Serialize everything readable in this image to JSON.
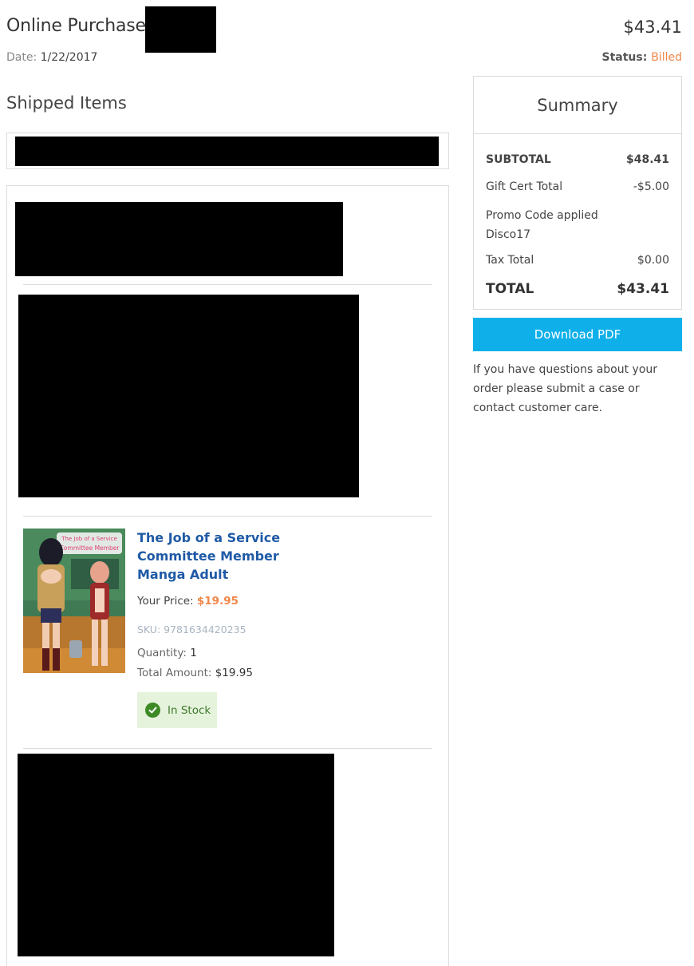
{
  "header": {
    "title": "Online Purchase",
    "date_label": "Date:",
    "date_value": "1/22/2017",
    "grand_total": "$43.41",
    "status_label": "Status:",
    "status_value": "Billed"
  },
  "shipped": {
    "title": "Shipped Items"
  },
  "product": {
    "name": "The Job of a Service Committee Member Manga Adult",
    "price_label": "Your Price:",
    "price_value": "$19.95",
    "sku_label": "SKU:",
    "sku_value": "9781634420235",
    "quantity_label": "Quantity:",
    "quantity_value": "1",
    "total_label": "Total Amount:",
    "total_value": "$19.95",
    "stock_status": "In Stock",
    "cover_title_line1": "The Job of a Service",
    "cover_title_line2": "Committee Member"
  },
  "summary": {
    "title": "Summary",
    "subtotal_label": "SUBTOTAL",
    "subtotal_value": "$48.41",
    "gift_label": "Gift Cert Total",
    "gift_value": "-$5.00",
    "promo_label": "Promo Code applied",
    "promo_code": "Disco17",
    "tax_label": "Tax Total",
    "tax_value": "$0.00",
    "total_label": "TOTAL",
    "total_value": "$43.41"
  },
  "actions": {
    "download_pdf": "Download PDF"
  },
  "help_text": "If you have questions about your order please submit a case or contact customer care.",
  "colors": {
    "accent_orange": "#f0874a",
    "link_blue": "#1f5aa6",
    "button_blue": "#0fb0ea",
    "stock_green": "#3d8a26"
  }
}
